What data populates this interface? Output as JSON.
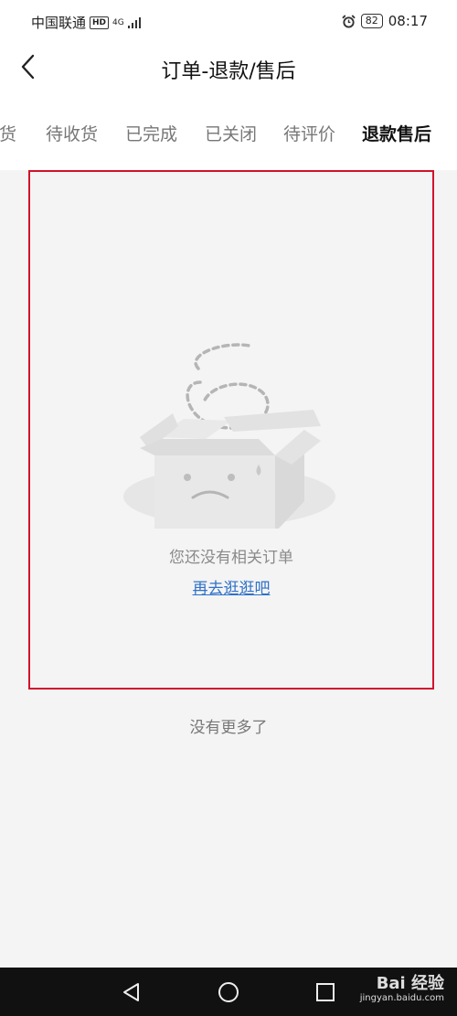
{
  "status_bar": {
    "carrier": "中国联通",
    "hd": "HD",
    "network": "4G",
    "battery": "82",
    "time": "08:17"
  },
  "header": {
    "title": "订单-退款/售后"
  },
  "tabs": [
    {
      "label": "发货",
      "visible_fragment": "货"
    },
    {
      "label": "待收货"
    },
    {
      "label": "已完成"
    },
    {
      "label": "已关闭"
    },
    {
      "label": "待评价"
    },
    {
      "label": "退款售后",
      "active": true
    }
  ],
  "empty_state": {
    "message": "您还没有相关订单",
    "link": "再去逛逛吧"
  },
  "footer_text": "没有更多了",
  "watermark": {
    "logo": "Bai 经验",
    "url": "jingyan.baidu.com"
  },
  "colors": {
    "accent": "#d0132b",
    "link": "#2f72c8"
  }
}
